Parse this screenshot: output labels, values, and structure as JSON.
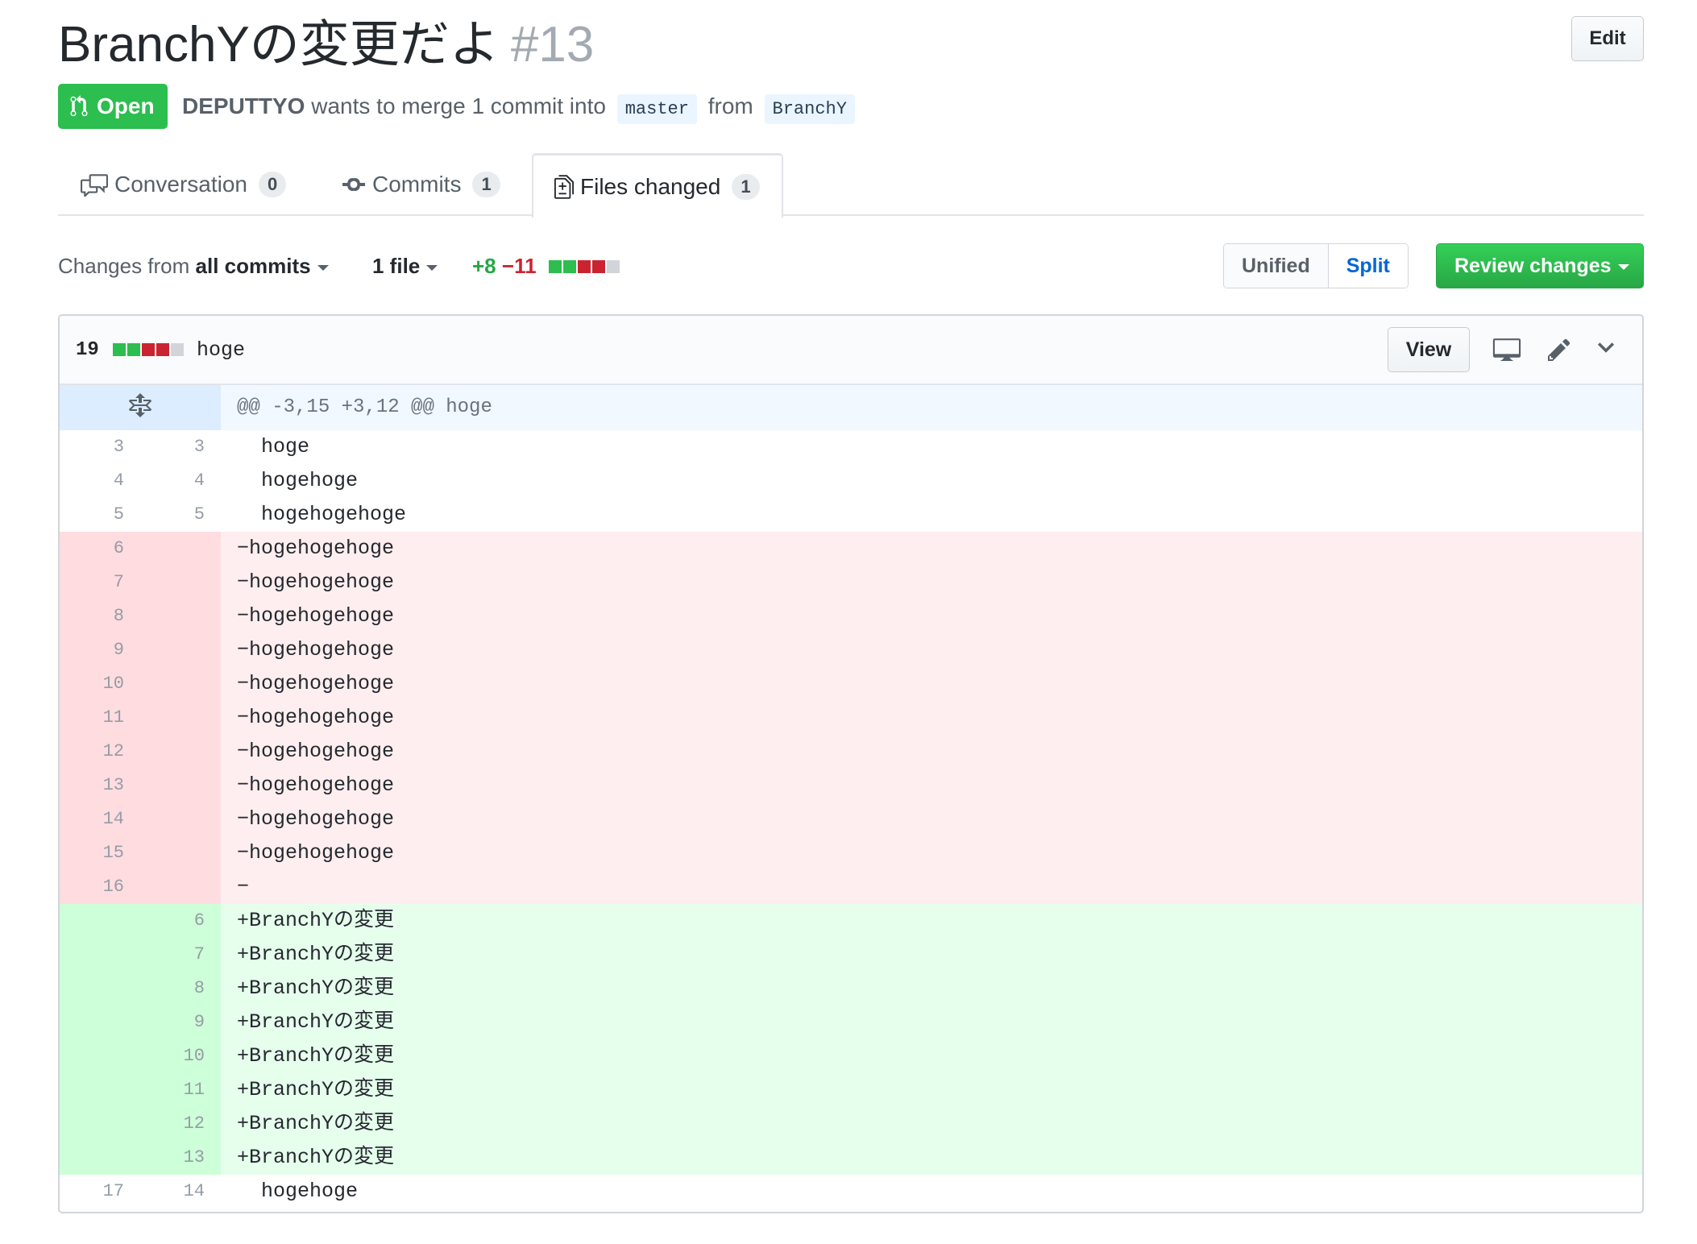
{
  "pr": {
    "title": "BranchYの変更だよ",
    "number": "#13",
    "edit_label": "Edit",
    "state": "Open",
    "author": "DEPUTTYO",
    "merge_text": " wants to merge 1 commit into ",
    "base_branch": "master",
    "from_text": " from ",
    "head_branch": "BranchY"
  },
  "tabs": [
    {
      "label": "Conversation",
      "count": "0"
    },
    {
      "label": "Commits",
      "count": "1"
    },
    {
      "label": "Files changed",
      "count": "1"
    }
  ],
  "toolbar": {
    "changes_prefix": "Changes from ",
    "changes_value": "all commits",
    "files_label": "1 file",
    "additions": "+8",
    "deletions": "−11",
    "view_unified": "Unified",
    "view_split": "Split",
    "review_label": "Review changes"
  },
  "file": {
    "changes": "19",
    "name": "hoge",
    "view_label": "View",
    "hunk_header": "@@ -3,15 +3,12 @@ hoge"
  },
  "colors": {
    "addition": "#28a745",
    "deletion": "#cb2431",
    "open_badge": "#2cbe4e",
    "link": "#0366d6"
  },
  "icons": [
    "git-pull-request-icon",
    "comment-discussion-icon",
    "git-commit-icon",
    "file-diff-icon",
    "unfold-icon",
    "desktop-icon",
    "pencil-icon",
    "chevron-down-icon"
  ],
  "diff_lines": [
    {
      "type": "ctx",
      "old": "3",
      "new": "3",
      "text": "  hoge"
    },
    {
      "type": "ctx",
      "old": "4",
      "new": "4",
      "text": "  hogehoge"
    },
    {
      "type": "ctx",
      "old": "5",
      "new": "5",
      "text": "  hogehogehoge"
    },
    {
      "type": "rem",
      "old": "6",
      "new": "",
      "text": "−hogehogehoge"
    },
    {
      "type": "rem",
      "old": "7",
      "new": "",
      "text": "−hogehogehoge"
    },
    {
      "type": "rem",
      "old": "8",
      "new": "",
      "text": "−hogehogehoge"
    },
    {
      "type": "rem",
      "old": "9",
      "new": "",
      "text": "−hogehogehoge"
    },
    {
      "type": "rem",
      "old": "10",
      "new": "",
      "text": "−hogehogehoge"
    },
    {
      "type": "rem",
      "old": "11",
      "new": "",
      "text": "−hogehogehoge"
    },
    {
      "type": "rem",
      "old": "12",
      "new": "",
      "text": "−hogehogehoge"
    },
    {
      "type": "rem",
      "old": "13",
      "new": "",
      "text": "−hogehogehoge"
    },
    {
      "type": "rem",
      "old": "14",
      "new": "",
      "text": "−hogehogehoge"
    },
    {
      "type": "rem",
      "old": "15",
      "new": "",
      "text": "−hogehogehoge"
    },
    {
      "type": "rem",
      "old": "16",
      "new": "",
      "text": "−"
    },
    {
      "type": "ins",
      "old": "",
      "new": "6",
      "text": "+BranchYの変更"
    },
    {
      "type": "ins",
      "old": "",
      "new": "7",
      "text": "+BranchYの変更"
    },
    {
      "type": "ins",
      "old": "",
      "new": "8",
      "text": "+BranchYの変更"
    },
    {
      "type": "ins",
      "old": "",
      "new": "9",
      "text": "+BranchYの変更"
    },
    {
      "type": "ins",
      "old": "",
      "new": "10",
      "text": "+BranchYの変更"
    },
    {
      "type": "ins",
      "old": "",
      "new": "11",
      "text": "+BranchYの変更"
    },
    {
      "type": "ins",
      "old": "",
      "new": "12",
      "text": "+BranchYの変更"
    },
    {
      "type": "ins",
      "old": "",
      "new": "13",
      "text": "+BranchYの変更"
    },
    {
      "type": "ctx",
      "old": "17",
      "new": "14",
      "text": "  hogehoge"
    }
  ]
}
